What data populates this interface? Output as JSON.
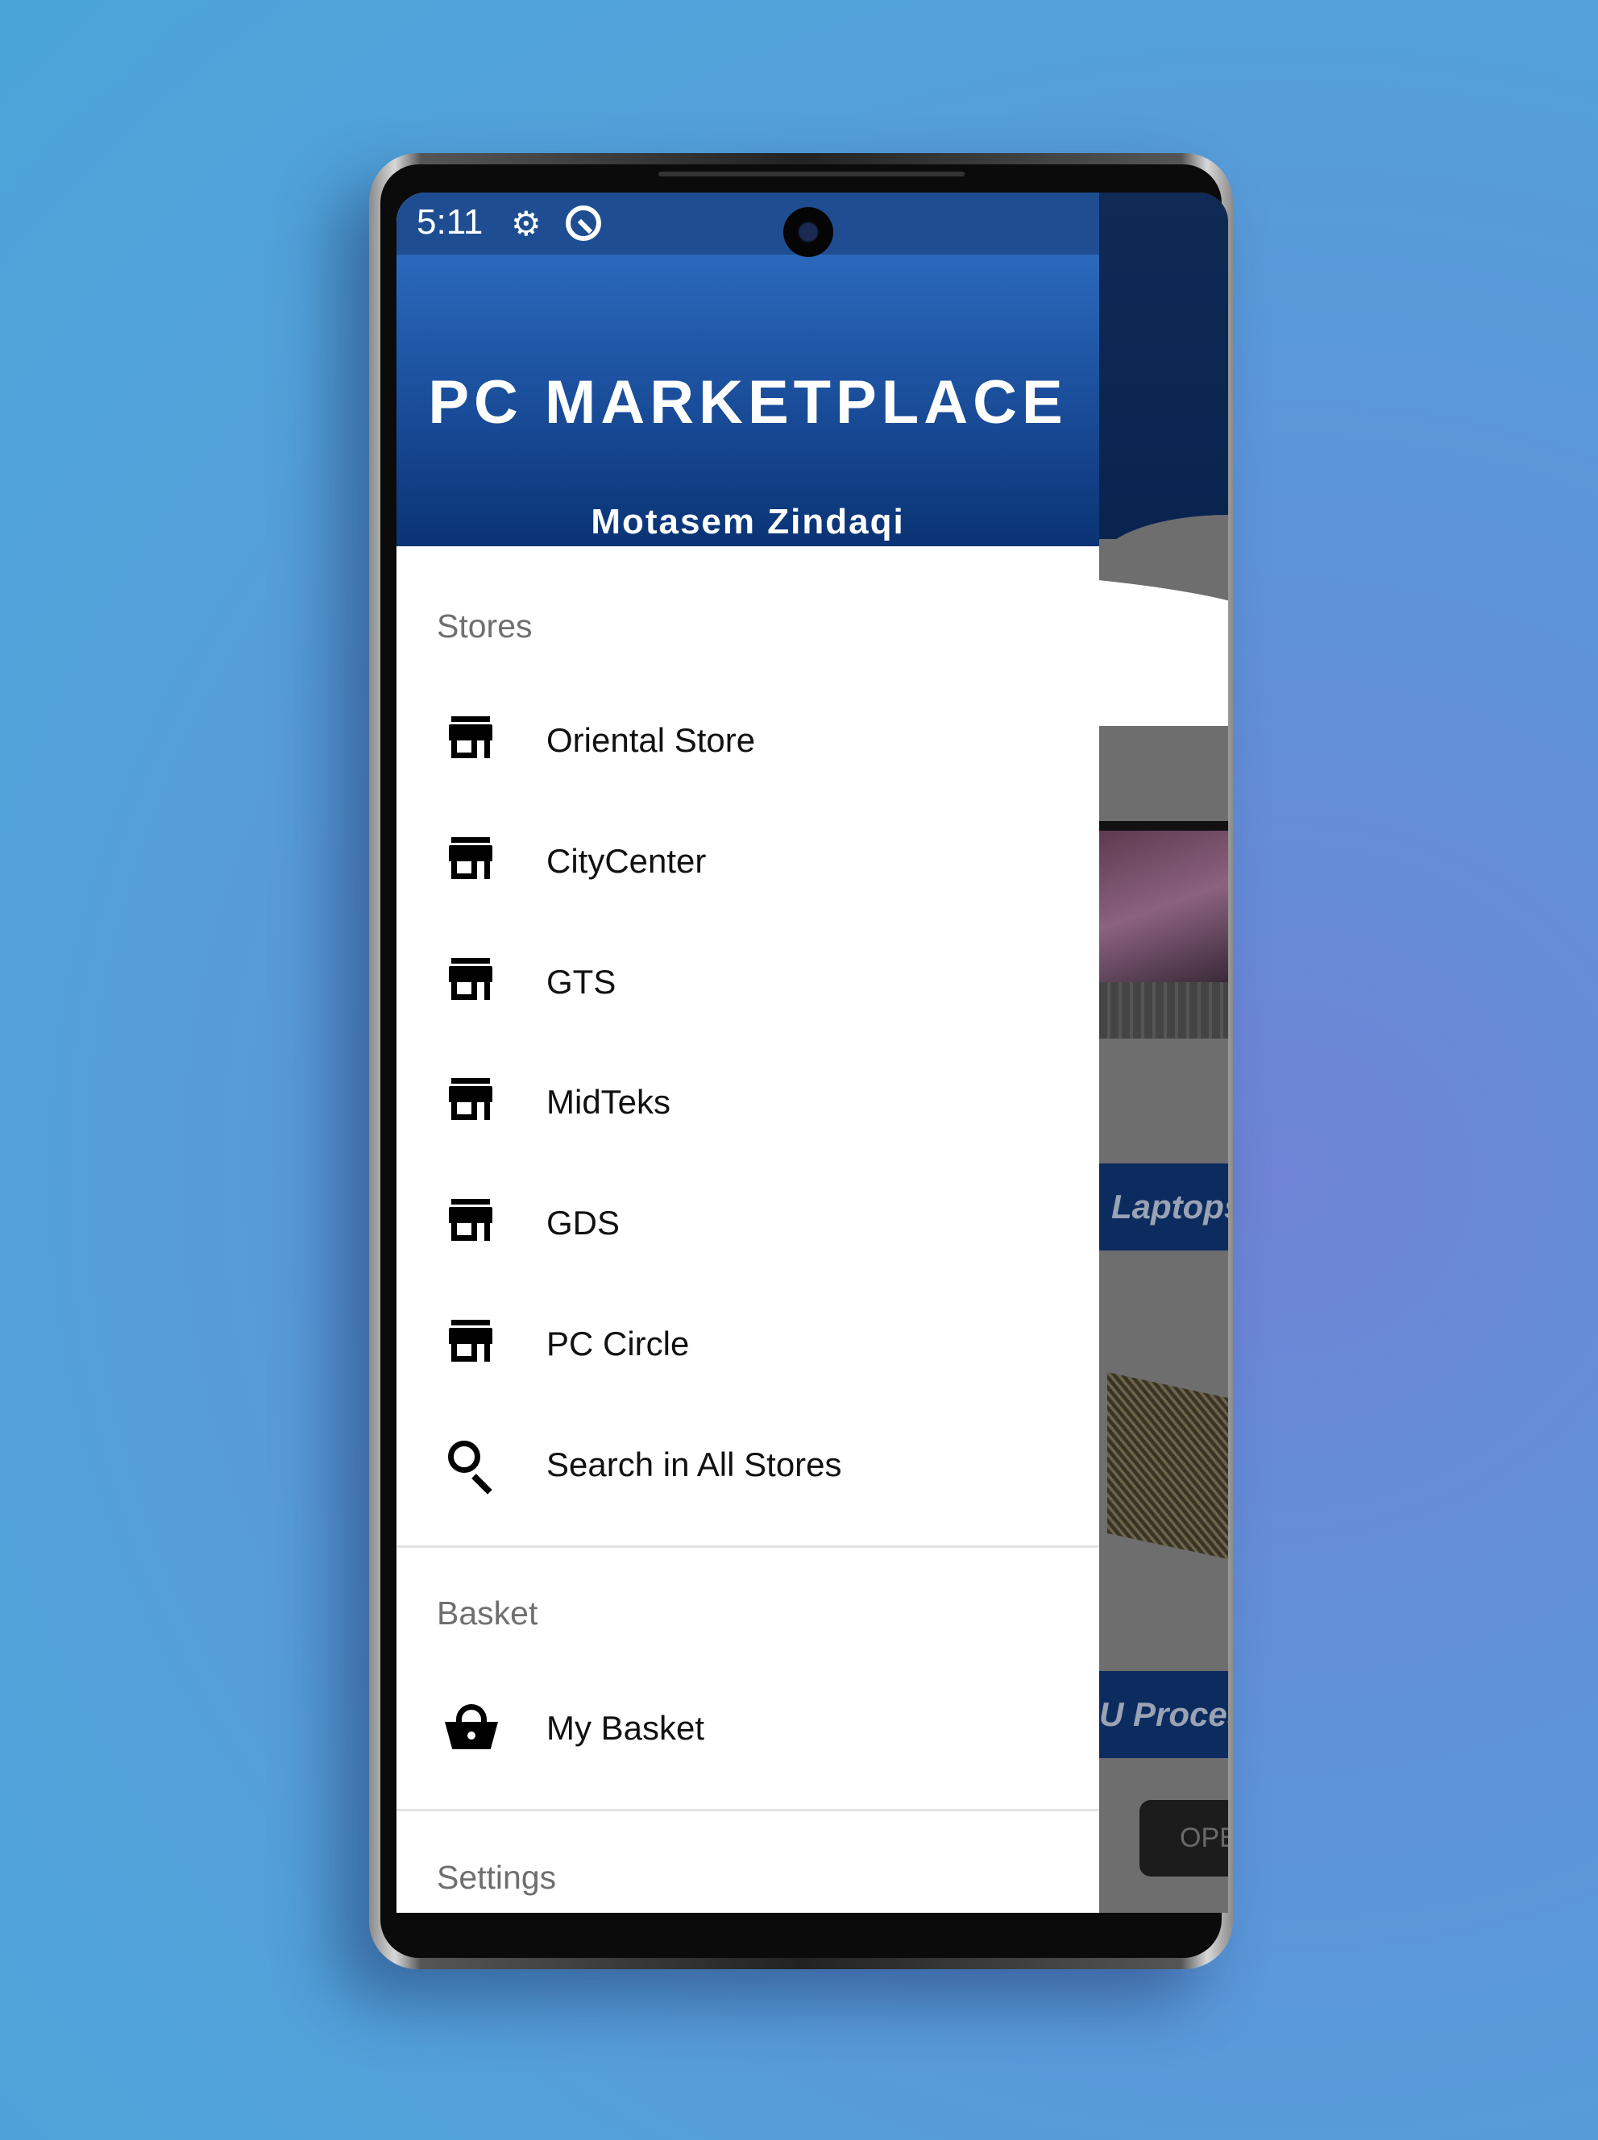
{
  "status_bar": {
    "time": "5:11",
    "icons": [
      "gear-icon",
      "sync-icon"
    ]
  },
  "header": {
    "title": "PC MARKETPLACE",
    "user_name": "Motasem Zindaqi",
    "colors": {
      "primary": "#1a4e9b",
      "dark": "#0a3374"
    }
  },
  "drawer": {
    "stores_label": "Stores",
    "stores": [
      {
        "label": "Oriental Store",
        "icon": "store-icon"
      },
      {
        "label": "CityCenter",
        "icon": "store-icon"
      },
      {
        "label": "GTS",
        "icon": "store-icon"
      },
      {
        "label": "MidTeks",
        "icon": "store-icon"
      },
      {
        "label": "GDS",
        "icon": "store-icon"
      },
      {
        "label": "PC Circle",
        "icon": "store-icon"
      },
      {
        "label": "Search in All Stores",
        "icon": "search-icon"
      }
    ],
    "basket_label": "Basket",
    "basket_item": {
      "label": "My Basket",
      "icon": "basket-icon"
    },
    "settings_label": "Settings"
  },
  "background_content": {
    "banner1": "Laptops",
    "banner2": "U Proces",
    "button": "OPE"
  }
}
